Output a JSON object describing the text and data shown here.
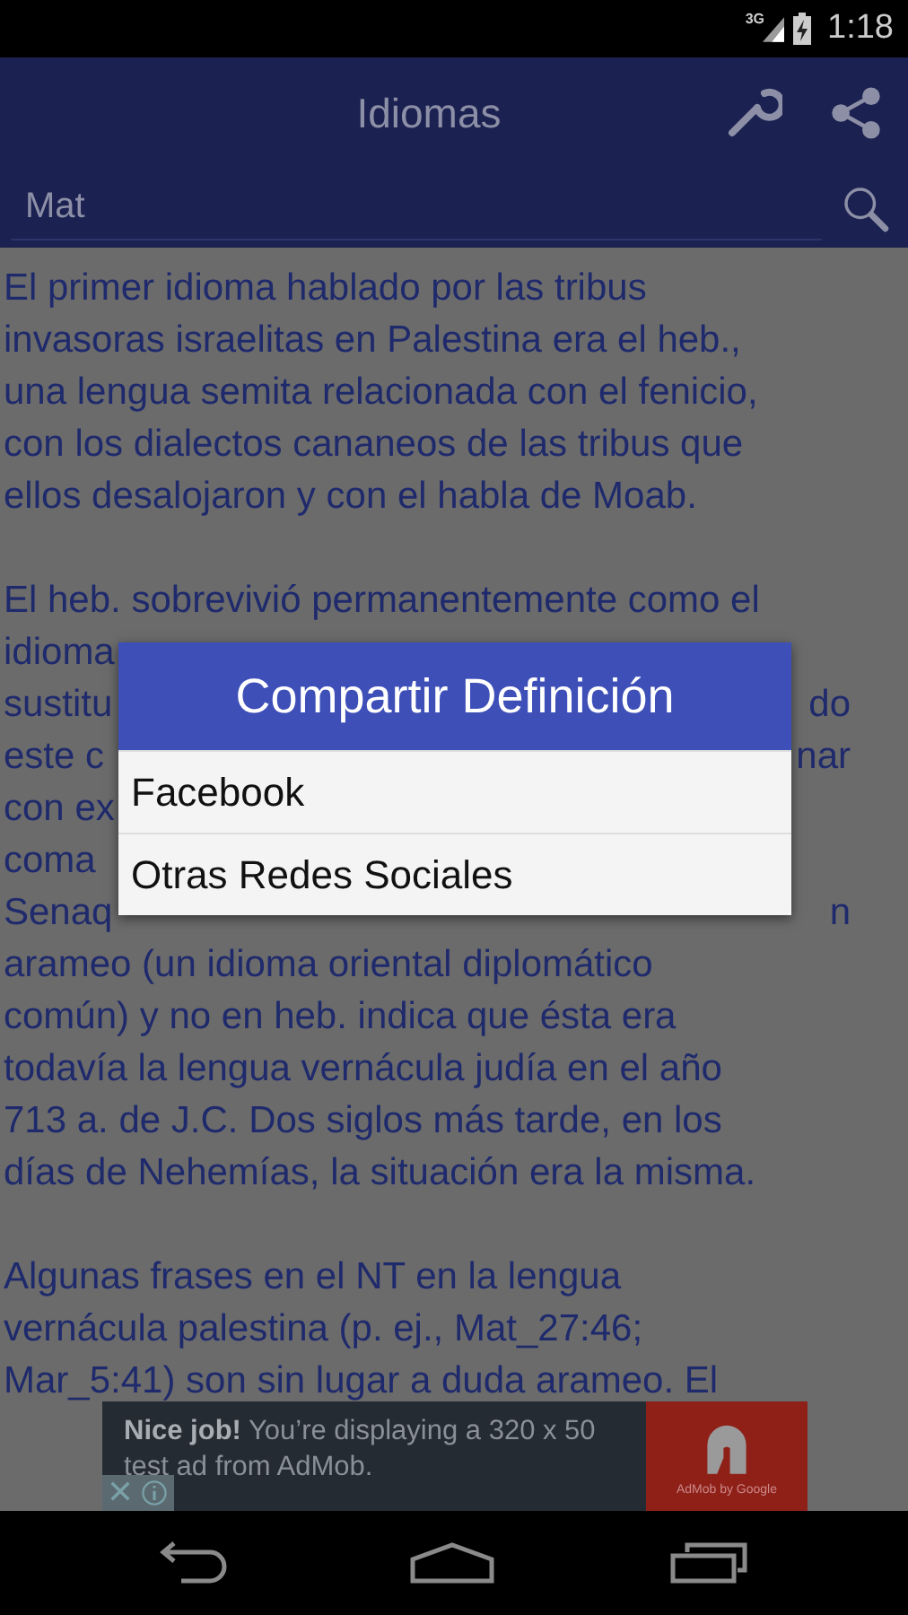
{
  "status_bar": {
    "network": "3G",
    "time": "1:18"
  },
  "toolbar": {
    "title": "Idiomas"
  },
  "search": {
    "value": "Mat"
  },
  "article": {
    "paragraphs": [
      {
        "lines": [
          {
            "left": "El primer idioma hablado por las tribus"
          },
          {
            "left": "invasoras israelitas en Palestina era el heb.,"
          },
          {
            "left": "una lengua semita relacionada con el fenicio,"
          },
          {
            "left": "con los dialectos cananeos de las tribus que"
          },
          {
            "left": "ellos desalojaron y con el habla de Moab."
          }
        ]
      },
      {
        "lines": [
          {
            "left": "El heb. sobrevivió permanentemente como el"
          },
          {
            "left": "idioma"
          },
          {
            "left": "sustitu",
            "right": "do"
          },
          {
            "left": "este c",
            "right": "nar"
          },
          {
            "left": "con ex"
          },
          {
            "left": "coma"
          },
          {
            "left": "Senaq",
            "right": "n"
          },
          {
            "left": "arameo (un idioma oriental diplomático"
          },
          {
            "left": "común) y no en heb. indica que ésta era"
          },
          {
            "left": "todavía la lengua vernácula judía en el año"
          },
          {
            "left": "713 a. de J.C. Dos siglos más tarde, en los"
          },
          {
            "left": "días de Nehemías, la situación era la misma."
          }
        ]
      },
      {
        "lines": [
          {
            "left": "Algunas frases en el NT en la lengua"
          },
          {
            "left": "vernácula palestina (p. ej., Mat_27:46;"
          },
          {
            "left": "Mar_5:41) son sin lugar a duda arameo. El"
          }
        ]
      }
    ]
  },
  "dialog": {
    "title": "Compartir Definición",
    "options": [
      "Facebook",
      "Otras Redes Sociales"
    ]
  },
  "ad": {
    "text": "**Nice job!** You’re displaying a 320 x 50 test ad from AdMob.",
    "brand": "AdMob by Google"
  }
}
